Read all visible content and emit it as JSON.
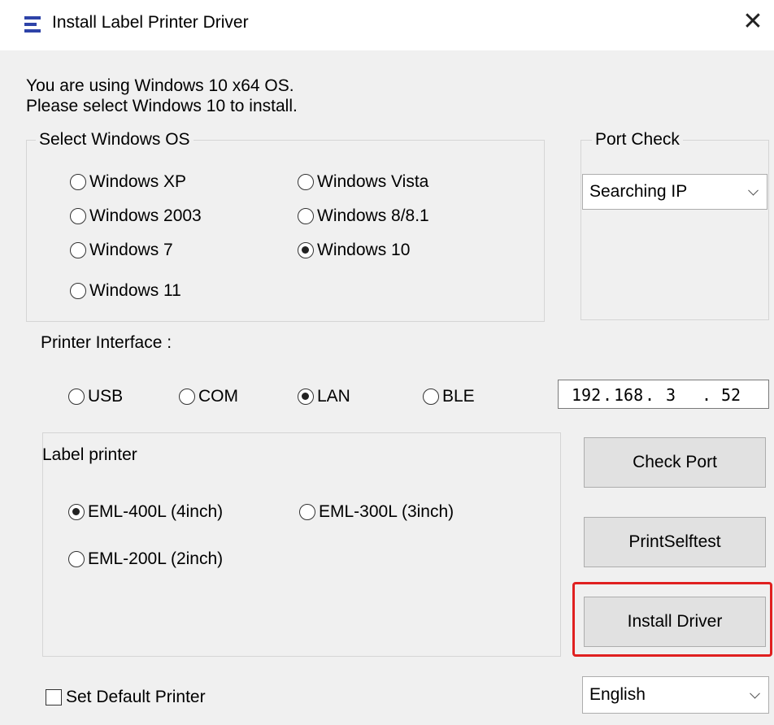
{
  "window": {
    "title": "Install Label Printer Driver",
    "close_glyph": "✕"
  },
  "message": {
    "line1": "You are using Windows 10 x64 OS.",
    "line2": "Please select Windows 10 to install."
  },
  "os_group": {
    "label": "Select Windows OS",
    "options": [
      {
        "label": "Windows XP",
        "selected": false
      },
      {
        "label": "Windows Vista",
        "selected": false
      },
      {
        "label": "Windows 2003",
        "selected": false
      },
      {
        "label": "Windows 8/8.1",
        "selected": false
      },
      {
        "label": "Windows 7",
        "selected": false
      },
      {
        "label": "Windows 10",
        "selected": true
      },
      {
        "label": "Windows 11",
        "selected": false
      }
    ]
  },
  "port_check": {
    "label": "Port Check",
    "selected": "Searching IP"
  },
  "interface": {
    "label": "Printer Interface :",
    "options": [
      {
        "label": "USB",
        "selected": false
      },
      {
        "label": "COM",
        "selected": false
      },
      {
        "label": "LAN",
        "selected": true
      },
      {
        "label": "BLE",
        "selected": false
      }
    ],
    "ip": [
      "192",
      "168",
      "3",
      "52"
    ]
  },
  "label_printer": {
    "label": "Label printer",
    "options": [
      {
        "label": "EML-400L (4inch)",
        "selected": true
      },
      {
        "label": "EML-300L (3inch)",
        "selected": false
      },
      {
        "label": "EML-200L (2inch)",
        "selected": false
      }
    ]
  },
  "buttons": {
    "check_port": "Check Port",
    "print_selftest": "PrintSelftest",
    "install_driver": "Install Driver"
  },
  "default_printer": {
    "label": "Set Default Printer",
    "checked": false
  },
  "language": {
    "selected": "English"
  },
  "colors": {
    "highlight": "#e02020",
    "icon": "#2e43a8"
  }
}
